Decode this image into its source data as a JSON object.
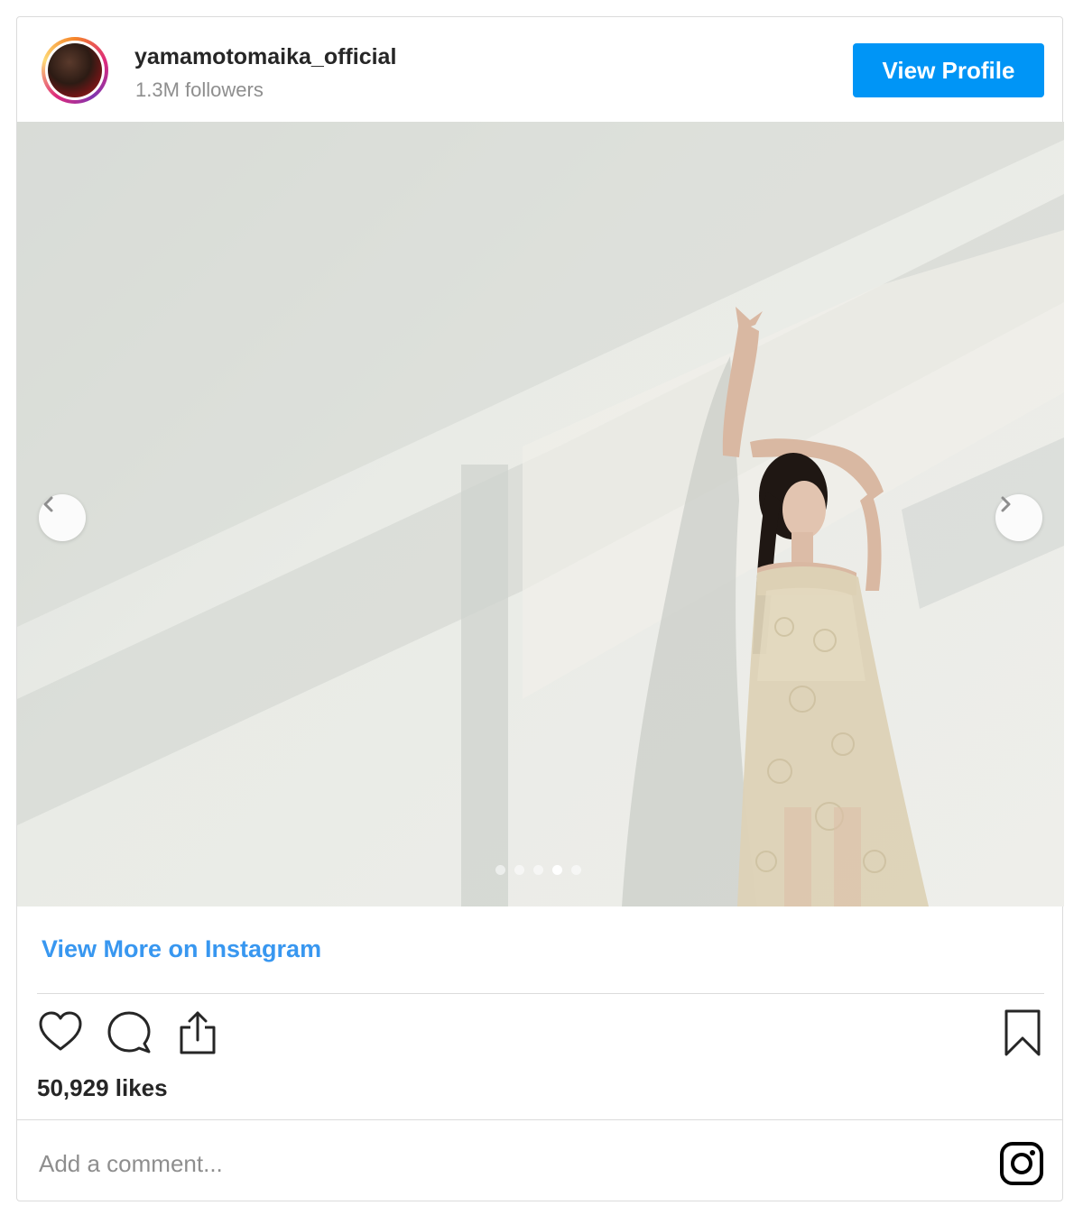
{
  "header": {
    "username": "yamamotomaika_official",
    "followers": "1.3M followers",
    "view_profile_label": "View Profile"
  },
  "media": {
    "carousel_total": 5,
    "carousel_active_index": 3,
    "prev_icon": "chevron-left-icon",
    "next_icon": "chevron-right-icon"
  },
  "links": {
    "view_more": "View More on Instagram"
  },
  "actions": {
    "icons": [
      "heart-icon",
      "comment-icon",
      "share-icon",
      "bookmark-icon"
    ]
  },
  "likes": "50,929 likes",
  "comment": {
    "placeholder": "Add a comment..."
  },
  "colors": {
    "accent": "#0095f6",
    "link": "#3897f0",
    "border": "#dbdbdb"
  }
}
